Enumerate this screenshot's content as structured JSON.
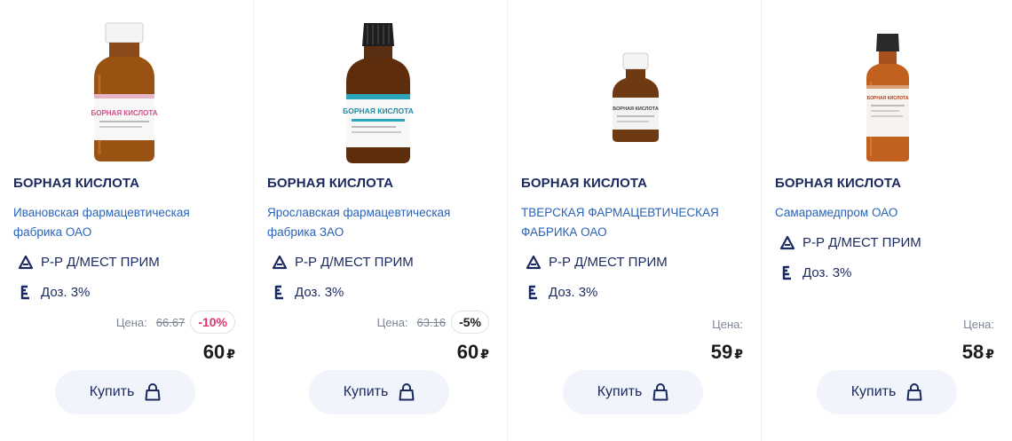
{
  "products": [
    {
      "name": "БОРНАЯ КИСЛОТА",
      "maker": "Ивановская фармацевтическая фабрика ОАО",
      "form": "Р-Р Д/МЕСТ ПРИМ",
      "dose": "Доз. 3%",
      "price_label": "Цена:",
      "old_price": "66.67",
      "discount": "-10%",
      "discount_color": "#e0336b",
      "price": "60",
      "currency": "₽",
      "buy_label": "Купить",
      "label_text": "БОРНАЯ КИСЛОТА"
    },
    {
      "name": "БОРНАЯ КИСЛОТА",
      "maker": "Ярославская фармацевтическая фабрика ЗАО",
      "form": "Р-Р Д/МЕСТ ПРИМ",
      "dose": "Доз. 3%",
      "price_label": "Цена:",
      "old_price": "63.16",
      "discount": "-5%",
      "discount_color": "#1c1c1c",
      "price": "60",
      "currency": "₽",
      "buy_label": "Купить",
      "label_text": "БОРНАЯ КИСЛОТА"
    },
    {
      "name": "БОРНАЯ КИСЛОТА",
      "maker": "ТВЕРСКАЯ ФАРМАЦЕВТИЧЕСКАЯ ФАБРИКА ОАО",
      "form": "Р-Р Д/МЕСТ ПРИМ",
      "dose": "Доз. 3%",
      "price_label": "Цена:",
      "price": "59",
      "currency": "₽",
      "buy_label": "Купить",
      "label_text": "БОРНАЯ КИСЛОТА"
    },
    {
      "name": "БОРНАЯ КИСЛОТА",
      "maker": "Самарамедпром ОАО",
      "form": "Р-Р Д/МЕСТ ПРИМ",
      "dose": "Доз. 3%",
      "price_label": "Цена:",
      "price": "58",
      "currency": "₽",
      "buy_label": "Купить",
      "label_text": "БОРНАЯ КИСЛОТА"
    }
  ],
  "colors": {
    "title": "#1b2a5e",
    "maker_link": "#2a63b8",
    "button_bg": "#f1f4fb",
    "discount_red": "#e0336b"
  },
  "icons": {
    "form": "triangle-icon",
    "dose": "dose-scale-icon",
    "buy": "shopping-bag-icon"
  }
}
